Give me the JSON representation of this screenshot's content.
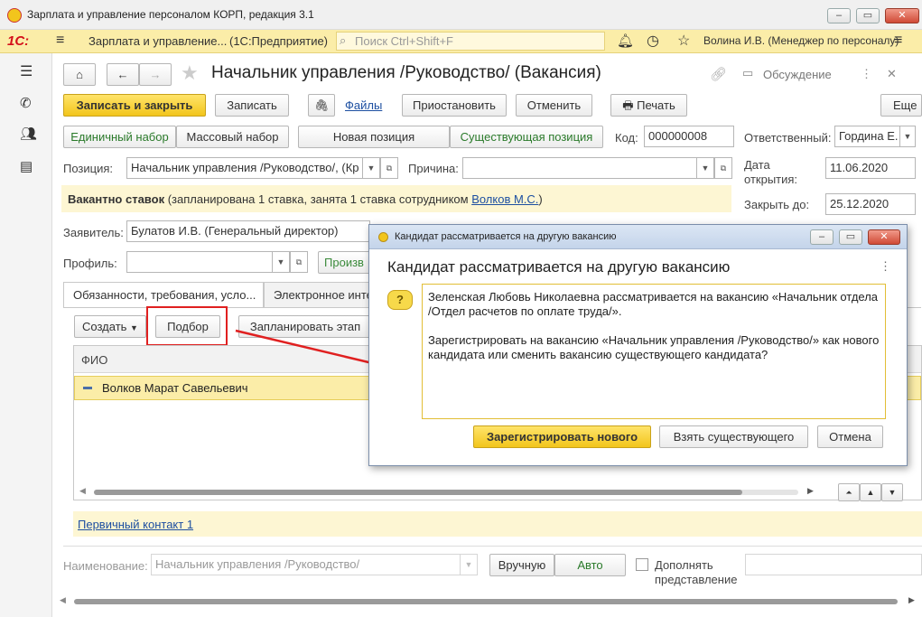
{
  "window": {
    "title": "Зарплата и управление персоналом КОРП, редакция 3.1"
  },
  "appbar": {
    "logo": "1С:",
    "app_name": "Зарплата и управление...",
    "platform": "(1С:Предприятие)",
    "search_placeholder": "Поиск Ctrl+Shift+F",
    "user": "Волина И.В. (Менеджер по персоналу)"
  },
  "form": {
    "title": "Начальник управления /Руководство/ (Вакансия)",
    "discussion": "Обсуждение",
    "toolbar": {
      "save_close": "Записать и закрыть",
      "save": "Записать",
      "files": "Файлы",
      "suspend": "Приостановить",
      "cancel": "Отменить",
      "print": "Печать",
      "more": "Еще"
    },
    "mode": {
      "single": "Единичный набор",
      "mass": "Массовый набор",
      "new_pos": "Новая позиция",
      "existing_pos": "Существующая позиция"
    },
    "code_label": "Код:",
    "code": "000000008",
    "responsible_label": "Ответственный:",
    "responsible": "Гордина Е.",
    "position_label": "Позиция:",
    "position": "Начальник управления /Руководство/, (Кр",
    "reason_label": "Причина:",
    "open_date_label": "Дата открытия:",
    "open_date": "11.06.2020",
    "close_label": "Закрыть до:",
    "close_date": "25.12.2020",
    "vacancy_info_bold": "Вакантно ставок",
    "vacancy_info": " (запланирована 1 ставка, занята 1 ставка сотрудником ",
    "vacancy_employee": "Волков М.С.",
    "vacancy_close": ")",
    "applicant_label": "Заявитель:",
    "applicant": "Булатов И.В. (Генеральный директор)",
    "profile_label": "Профиль:",
    "prof_btn": "Произв",
    "tabs": [
      "Обязанности, требования, усло...",
      "Электронное инте"
    ],
    "list": {
      "create": "Создать",
      "pick": "Подбор",
      "plan": "Запланировать этап",
      "col_fio": "ФИО",
      "rows": [
        "Волков Марат Савельевич"
      ]
    },
    "first_contact": "Первичный контакт 1",
    "name_label": "Наименование:",
    "name_value": "Начальник управления /Руководство/",
    "manual": "Вручную",
    "auto": "Авто",
    "complement": "Дополнять",
    "representation": "представление"
  },
  "dialog": {
    "window_title": "Кандидат рассматривается на другую вакансию",
    "heading": "Кандидат рассматривается на другую вакансию",
    "text1": "Зеленская Любовь Николаевна рассматривается на вакансию «Начальник отдела /Отдел расчетов по оплате труда/».",
    "text2": "Зарегистрировать на вакансию «Начальник управления /Руководство/» как нового кандидата или сменить вакансию существующего кандидата?",
    "register_new": "Зарегистрировать нового",
    "take_existing": "Взять существующего",
    "cancel": "Отмена"
  },
  "colors": {
    "accent_yellow": "#f2c51c",
    "header_bg": "#fbeda8",
    "info_bg": "#fdf6d3",
    "highlight_red": "#e02020",
    "link": "#1d4fa1"
  }
}
